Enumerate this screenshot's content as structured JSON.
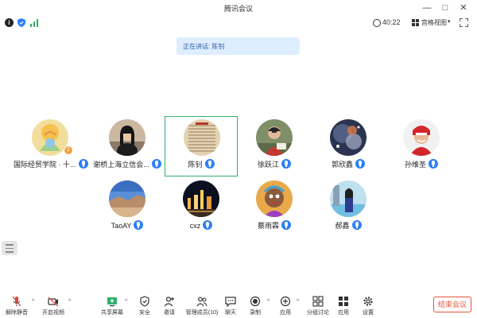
{
  "window": {
    "title": "腾讯会议",
    "minimize": "—",
    "maximize": "□",
    "close": "✕"
  },
  "topbar": {
    "info": "i",
    "timer": "40:22",
    "view_label": "宫格视图",
    "chevron": "▾"
  },
  "subtitle": {
    "text": "正在讲话: 陈钊"
  },
  "participants": [
    {
      "name": "国际经贸学院 · 十...",
      "badge": "2"
    },
    {
      "name": "谢桥上海立信会..."
    },
    {
      "name": "陈钊",
      "active": true
    },
    {
      "name": "徐跃江"
    },
    {
      "name": "郭欣鑫"
    },
    {
      "name": "孙维圣"
    },
    {
      "name": "TaoAY"
    },
    {
      "name": "cxz"
    },
    {
      "name": "蔡雨霖"
    },
    {
      "name": "郝鑫"
    }
  ],
  "toolbar": {
    "mute": "解除静音",
    "video": "开启视频",
    "share": "共享屏幕",
    "security": "安全",
    "invite": "邀请",
    "members": "管理成员(10)",
    "chat": "聊天",
    "record": "录制",
    "apps": "应用",
    "breakout": "分组讨论",
    "more_apps": "应用",
    "settings": "设置",
    "end": "结束会议",
    "caret": "^"
  },
  "colors": {
    "accent_blue": "#2d7ff9",
    "active_border": "#2fb06c",
    "end_red": "#e8543b",
    "subtitle_bg": "#dfeeff"
  }
}
